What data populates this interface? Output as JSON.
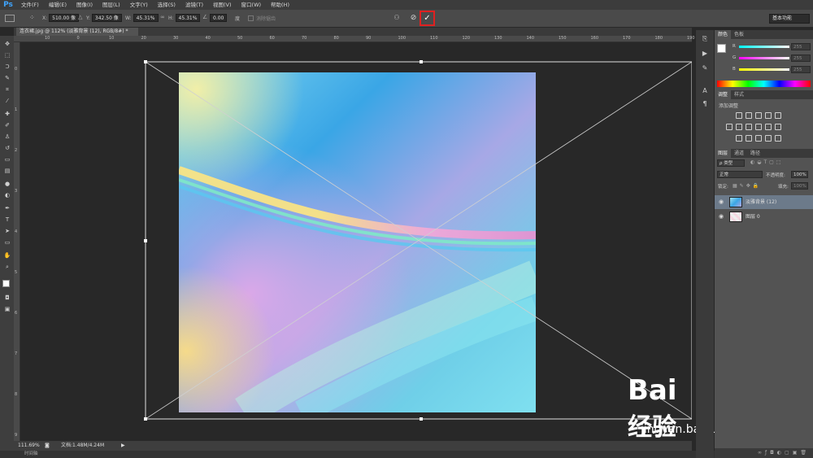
{
  "menubar": {
    "logo": "Ps",
    "items": [
      "文件(F)",
      "编辑(E)",
      "图像(I)",
      "图层(L)",
      "文字(Y)",
      "选择(S)",
      "滤镜(T)",
      "视图(V)",
      "窗口(W)",
      "帮助(H)"
    ]
  },
  "options": {
    "x_label": "X:",
    "x_value": "510.00 像",
    "y_label": "Y:",
    "y_value": "342.50 像",
    "w_label": "W:",
    "w_value": "45.31%",
    "h_label": "H:",
    "h_value": "45.31%",
    "angle_value": "0.00",
    "interp_label": "度",
    "antialias_label": "消除锯齿",
    "commit_icon": "checkmark-icon",
    "cancel_icon": "cancel-icon",
    "workspace": "基本功能"
  },
  "document": {
    "tab_title": "连衣裙.jpg @ 112% (淡雅背景 (12), RGB/8#) *"
  },
  "rulers": {
    "h_ticks": [
      "10",
      "0",
      "10",
      "20",
      "30",
      "40",
      "50",
      "60",
      "70",
      "80",
      "90",
      "100",
      "110",
      "120",
      "130",
      "140",
      "150",
      "160",
      "170",
      "180",
      "190"
    ],
    "v_ticks": [
      "0",
      "1",
      "2",
      "3",
      "4",
      "5",
      "6",
      "7",
      "8",
      "9"
    ]
  },
  "status": {
    "zoom": "111.69%",
    "doc_info": "文档:1.48M/4.24M"
  },
  "bottom": {
    "timeline": "时间轴"
  },
  "color_panel": {
    "tabs": [
      "颜色",
      "色板"
    ],
    "r_label": "R",
    "g_label": "G",
    "b_label": "B",
    "r_value": "255",
    "g_value": "255",
    "b_value": "255"
  },
  "adjust_panel": {
    "tabs": [
      "调整",
      "样式"
    ],
    "add_label": "添加调整"
  },
  "layers_panel": {
    "tabs": [
      "图层",
      "通道",
      "路径"
    ],
    "kind_label": "ρ 类型",
    "blend_mode": "正常",
    "opacity_label": "不透明度:",
    "opacity_value": "100%",
    "lock_label": "锁定:",
    "fill_label": "填充:",
    "fill_value": "100%",
    "layers": [
      {
        "name": "淡雅背景 (12)",
        "selected": true
      },
      {
        "name": "图层 0",
        "selected": false
      }
    ]
  },
  "watermark": {
    "brand": "Bai",
    "brand_cn": "经验",
    "url": "jingyan.baidu.com"
  },
  "colors": {
    "accent_red": "#e02020",
    "highlight_blue": "#3ea4ff"
  }
}
